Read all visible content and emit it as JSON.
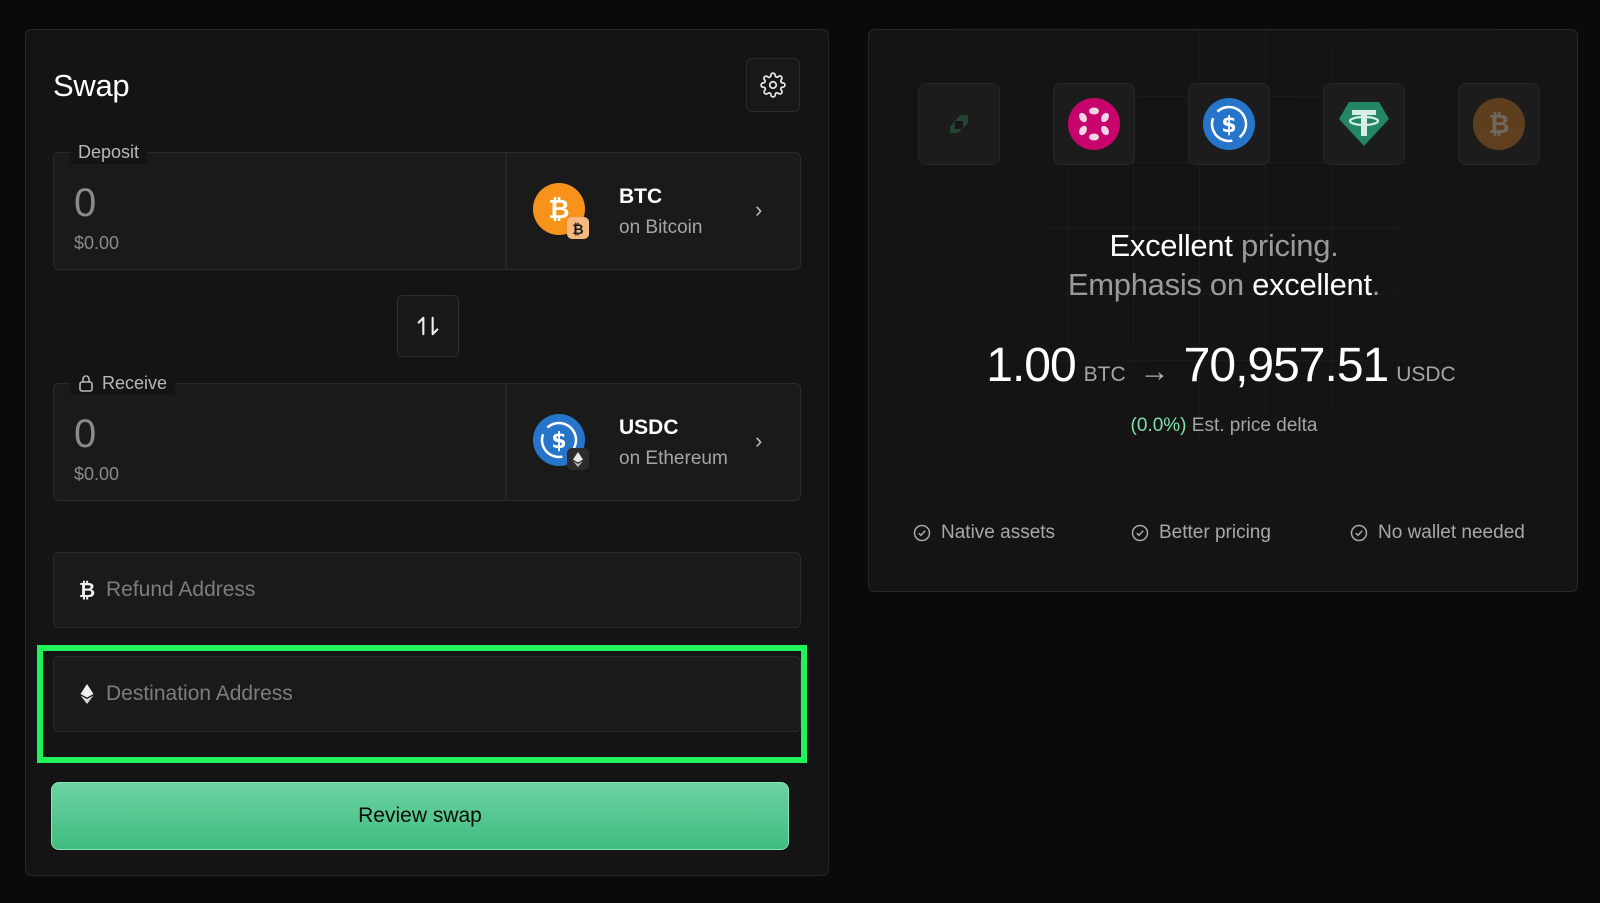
{
  "swap": {
    "title": "Swap",
    "deposit": {
      "label": "Deposit",
      "amount": "0",
      "usd_value": "$0.00",
      "token_symbol": "BTC",
      "token_chain": "on Bitcoin",
      "token_icon": "bitcoin-icon",
      "chain_icon": "bitcoin-chain-icon"
    },
    "receive": {
      "label": "Receive",
      "amount": "0",
      "usd_value": "$0.00",
      "token_symbol": "USDC",
      "token_chain": "on Ethereum",
      "token_icon": "usdc-icon",
      "chain_icon": "ethereum-chain-icon"
    },
    "refund_address": {
      "placeholder": "Refund Address",
      "value": ""
    },
    "destination_address": {
      "placeholder": "Destination Address",
      "value": ""
    },
    "review_label": "Review swap"
  },
  "info": {
    "coin_icons": [
      "green-token-icon",
      "polkadot-icon",
      "usdc-icon",
      "tether-icon",
      "bitcoin-icon"
    ],
    "headline": {
      "line1_bright": "Excellent",
      "line1_dim": "pricing.",
      "line2_dim": "Emphasis on",
      "line2_bright": "excellent",
      "line2_end": "."
    },
    "rate": {
      "from_amount": "1.00",
      "from_unit": "BTC",
      "arrow": "→",
      "to_amount": "70,957.51",
      "to_unit": "USDC"
    },
    "delta": {
      "value": "(0.0%)",
      "label": "Est. price delta"
    },
    "features": [
      "Native assets",
      "Better pricing",
      "No wallet needed"
    ]
  },
  "colors": {
    "accent_green": "#3fbc80",
    "highlight": "#1ff25a",
    "btc_orange": "#f7931a",
    "usdc_blue": "#2775ca",
    "polkadot_pink": "#e6007a",
    "tether_green": "#26a17b"
  }
}
